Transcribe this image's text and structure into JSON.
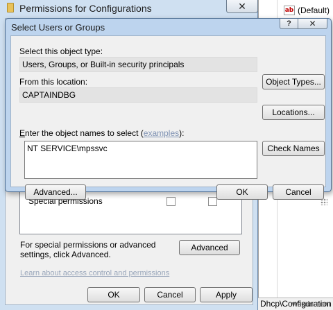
{
  "registry": {
    "default_value_label": "(Default)",
    "statusbar_path": "Dhcp\\Configuration",
    "watermark": "wsxdn.com"
  },
  "permissions_dialog": {
    "title": "Permissions for Configurations",
    "close_glyph": "✕",
    "special_permissions_label": "Special permissions",
    "advanced_text": "For special permissions or advanced settings, click Advanced.",
    "advanced_button": "Advanced",
    "learn_link": "Learn about access control and permissions",
    "ok_button": "OK",
    "cancel_button": "Cancel",
    "apply_button": "Apply"
  },
  "select_dialog": {
    "title": "Select Users or Groups",
    "help_glyph": "?",
    "close_glyph": "✕",
    "object_type_label": "Select this object type:",
    "object_type_value": "Users, Groups, or Built-in security principals",
    "object_types_button": "Object Types...",
    "location_label": "From this location:",
    "location_value": "CAPTAINDBG",
    "locations_button": "Locations...",
    "names_label_prefix": "E",
    "names_label_rest": "nter the object names to select (",
    "examples_link": "examples",
    "names_label_suffix": "):",
    "names_value": "NT SERVICE\\mpssvc",
    "check_names_button": "Check Names",
    "advanced_button": "Advanced...",
    "ok_button": "OK",
    "cancel_button": "Cancel"
  }
}
